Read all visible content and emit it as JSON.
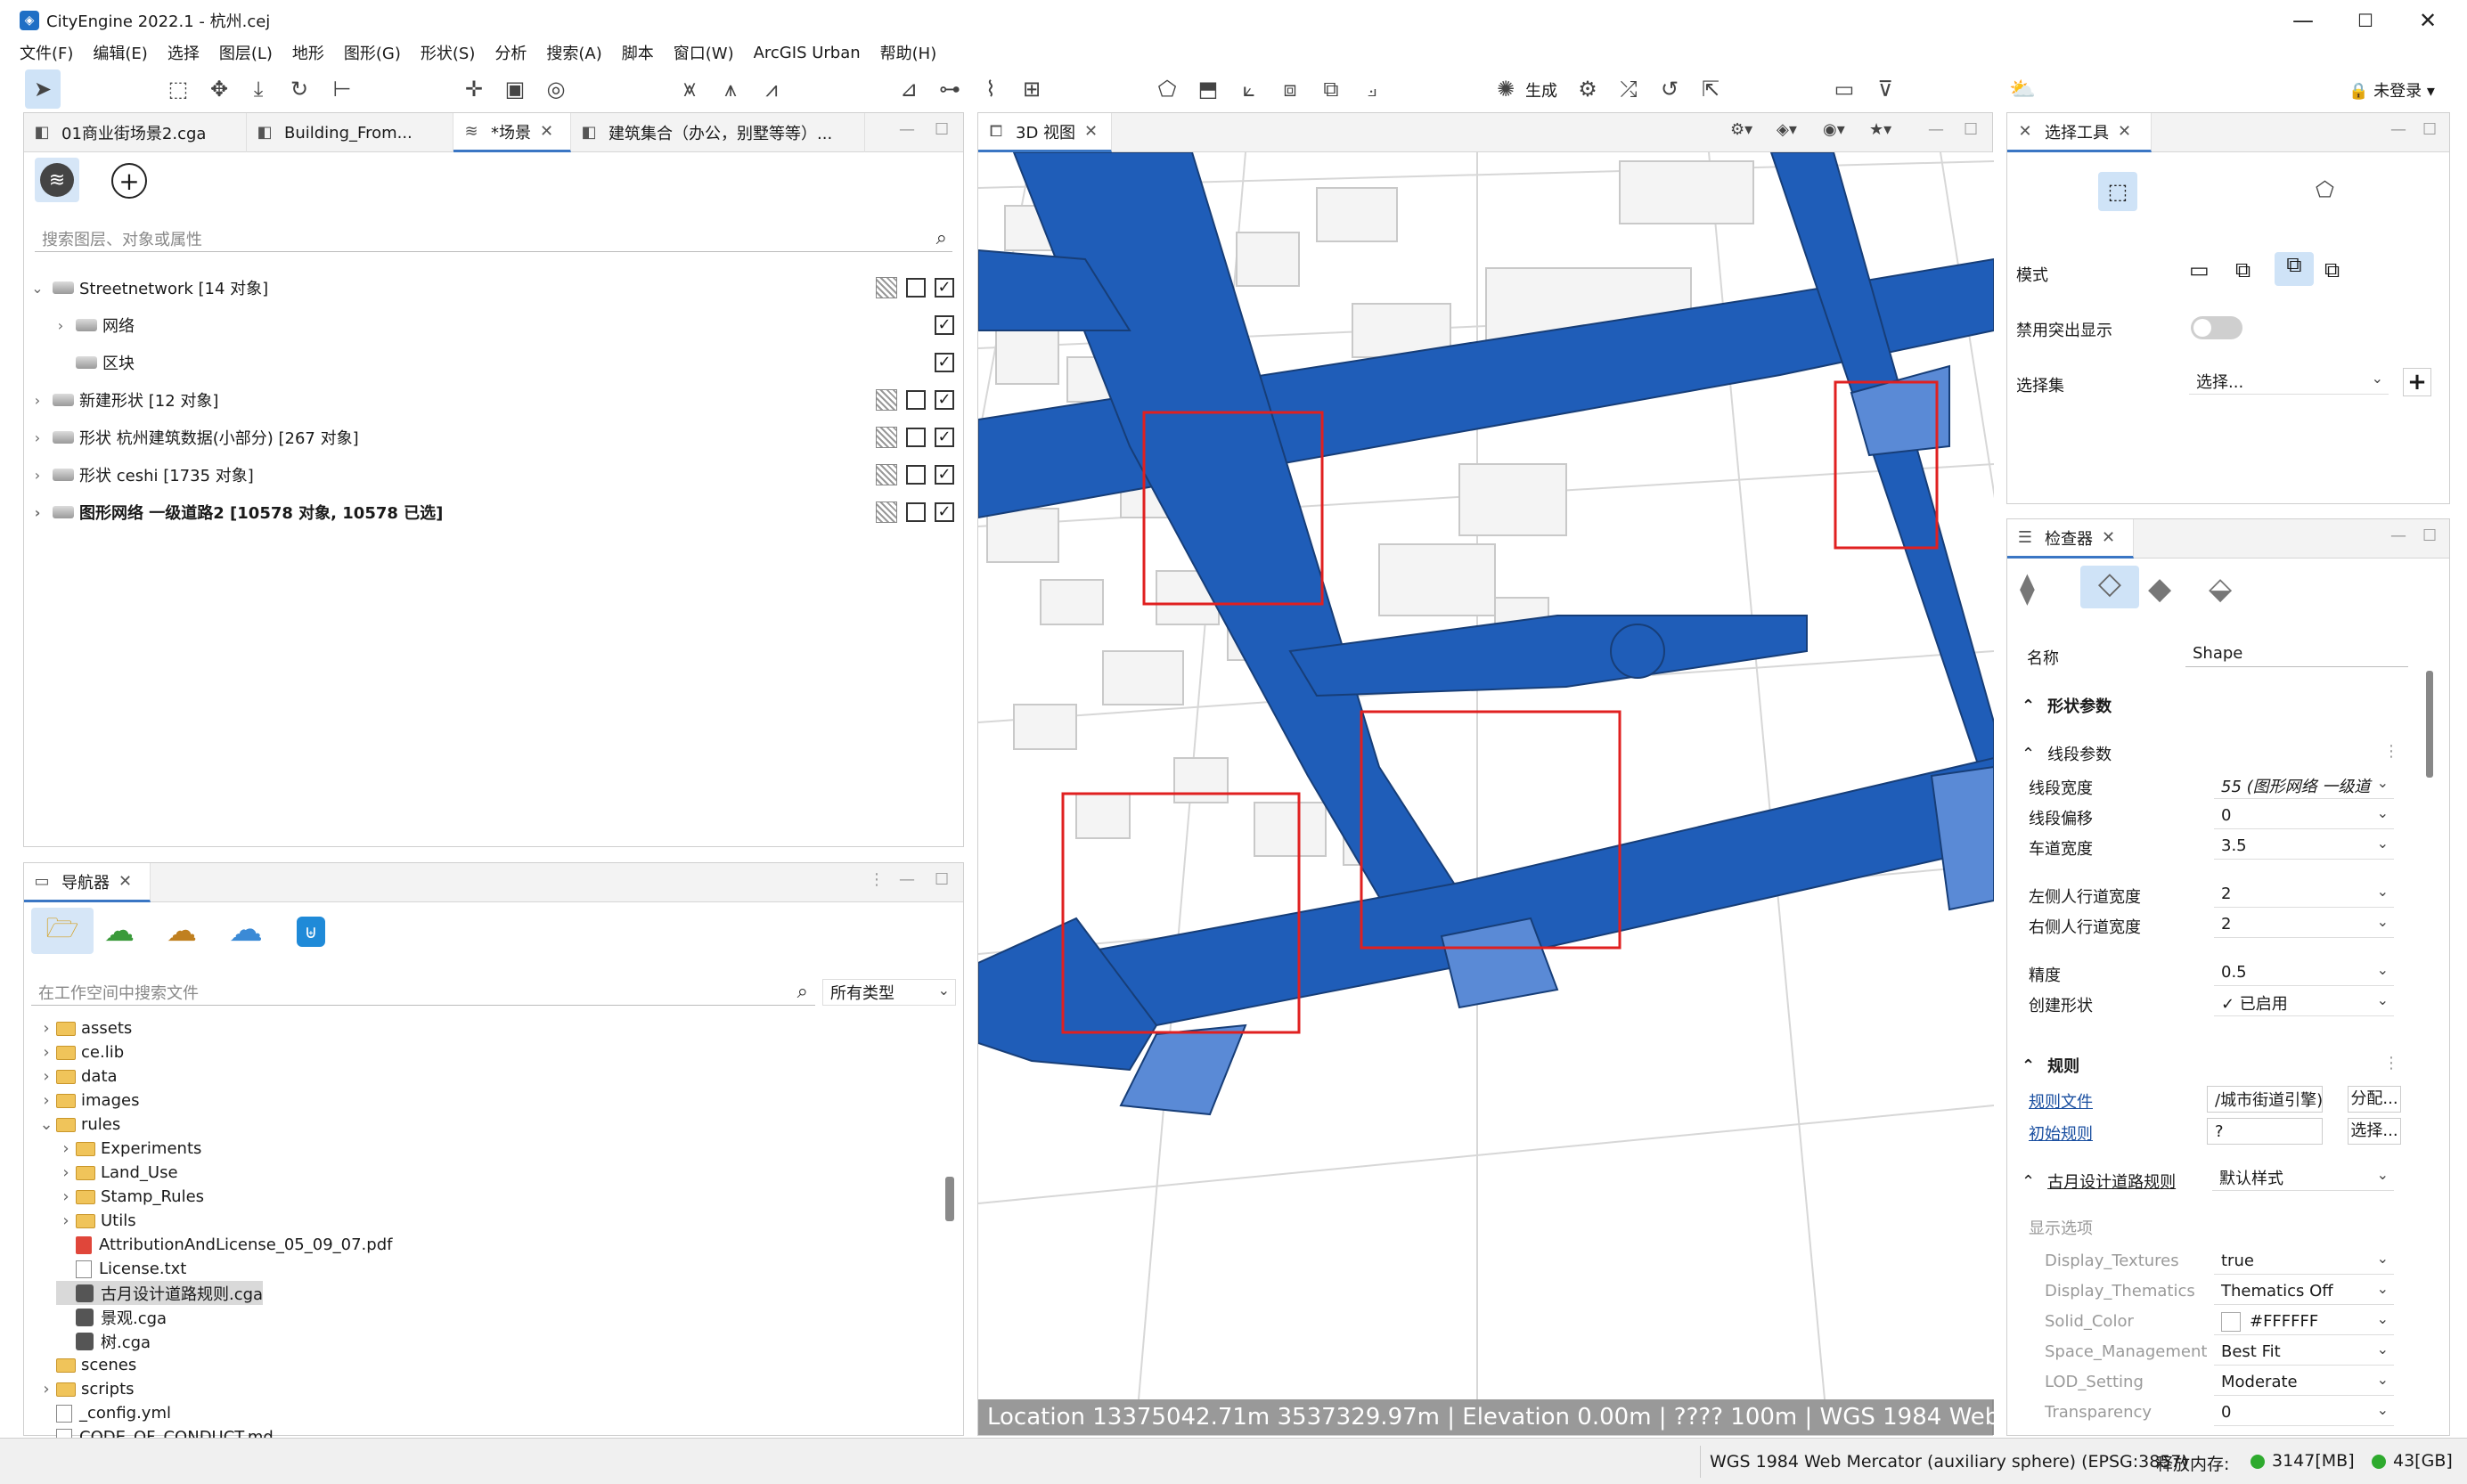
{
  "window": {
    "title": "CityEngine 2022.1 - 杭州.cej",
    "min": "—",
    "max": "☐",
    "close": "✕"
  },
  "menu": [
    "文件(F)",
    "编辑(E)",
    "选择",
    "图层(L)",
    "地形",
    "图形(G)",
    "形状(S)",
    "分析",
    "搜索(A)",
    "脚本",
    "窗口(W)",
    "ArcGIS Urban",
    "帮助(H)"
  ],
  "toolbar": {
    "generate_label": "生成",
    "login_label": "未登录"
  },
  "scene_panel": {
    "tabs": [
      "01商业街场景2.cga",
      "Building_From...",
      "*场景",
      "建筑集合（办公，别墅等等）..."
    ],
    "search_placeholder": "搜索图层、对象或属性",
    "layers": [
      {
        "label": "Streetnetwork [14 对象]",
        "bold": false
      },
      {
        "label": "网络",
        "bold": false
      },
      {
        "label": "区块",
        "bold": false
      },
      {
        "label": "新建形状 [12 对象]",
        "bold": false
      },
      {
        "label": "形状 杭州建筑数据(小部分) [267 对象]",
        "bold": false
      },
      {
        "label": "形状 ceshi [1735 对象]",
        "bold": false
      },
      {
        "label": "图形网络 一级道路2 [10578 对象, 10578 已选]",
        "bold": true
      }
    ]
  },
  "navigator": {
    "tab": "导航器",
    "search_placeholder": "在工作空间中搜索文件",
    "type_filter": "所有类型",
    "tree": [
      {
        "label": "assets",
        "kind": "folder",
        "indent": 1,
        "chev": "›"
      },
      {
        "label": "ce.lib",
        "kind": "folder",
        "indent": 1,
        "chev": "›"
      },
      {
        "label": "data",
        "kind": "folder",
        "indent": 1,
        "chev": "›"
      },
      {
        "label": "images",
        "kind": "folder",
        "indent": 1,
        "chev": "›"
      },
      {
        "label": "rules",
        "kind": "folder",
        "indent": 1,
        "chev": "⌄"
      },
      {
        "label": "Experiments",
        "kind": "folder",
        "indent": 2,
        "chev": "›"
      },
      {
        "label": "Land_Use",
        "kind": "folder",
        "indent": 2,
        "chev": "›"
      },
      {
        "label": "Stamp_Rules",
        "kind": "folder",
        "indent": 2,
        "chev": "›"
      },
      {
        "label": "Utils",
        "kind": "folder",
        "indent": 2,
        "chev": "›"
      },
      {
        "label": "AttributionAndLicense_05_09_07.pdf",
        "kind": "pdf",
        "indent": 2,
        "chev": ""
      },
      {
        "label": "License.txt",
        "kind": "file",
        "indent": 2,
        "chev": ""
      },
      {
        "label": "古月设计道路规则.cga",
        "kind": "cga",
        "indent": 2,
        "chev": "",
        "selected": true
      },
      {
        "label": "景观.cga",
        "kind": "cga",
        "indent": 2,
        "chev": ""
      },
      {
        "label": "树.cga",
        "kind": "cga",
        "indent": 2,
        "chev": ""
      },
      {
        "label": "scenes",
        "kind": "folder",
        "indent": 1,
        "chev": ""
      },
      {
        "label": "scripts",
        "kind": "folder",
        "indent": 1,
        "chev": "›"
      },
      {
        "label": "_config.yml",
        "kind": "file",
        "indent": 1,
        "chev": ""
      },
      {
        "label": "CODE_OF_CONDUCT.md",
        "kind": "file",
        "indent": 1,
        "chev": ""
      }
    ]
  },
  "viewport": {
    "tab": "3D 视图",
    "status": "Location 13375042.71m 3537329.97m  |  Elevation 0.00m   |  ???? 100m  |  WGS 1984 Web"
  },
  "select_tool": {
    "tab": "选择工具",
    "mode_label": "模式",
    "disable_highlight_label": "禁用突出显示",
    "selection_set_label": "选择集",
    "selection_set_value": "选择..."
  },
  "inspector": {
    "tab": "检查器",
    "name_label": "名称",
    "name_value": "Shape",
    "shape_params": "形状参数",
    "segment_params": "线段参数",
    "params": [
      {
        "label": "线段宽度",
        "value": "55 (图形网络 一级道"
      },
      {
        "label": "线段偏移",
        "value": "0"
      },
      {
        "label": "车道宽度",
        "value": "3.5"
      },
      {
        "label": "左侧人行道宽度",
        "value": "2"
      },
      {
        "label": "右侧人行道宽度",
        "value": "2"
      },
      {
        "label": "精度",
        "value": "0.5"
      },
      {
        "label": "创建形状",
        "value": "✓ 已启用"
      }
    ],
    "rules_section": "规则",
    "rule_file_label": "规则文件",
    "rule_file_value": "/城市街道引擎)",
    "assign_btn": "分配...",
    "start_rule_label": "初始规则",
    "start_rule_value": "?",
    "select_btn": "选择...",
    "rule_name": "古月设计道路规则",
    "rule_style": "默认样式",
    "display_options": "显示选项",
    "attrs": [
      {
        "label": "Display_Textures",
        "value": "true"
      },
      {
        "label": "Display_Thematics",
        "value": "Thematics Off"
      },
      {
        "label": "Solid_Color",
        "value": "#FFFFFF"
      },
      {
        "label": "Space_Management",
        "value": "Best Fit"
      },
      {
        "label": "LOD_Setting",
        "value": "Moderate"
      },
      {
        "label": "Transparency",
        "value": "0"
      }
    ]
  },
  "statusbar": {
    "crs": "WGS 1984 Web Mercator (auxiliary sphere) (EPSG:3857)",
    "free_mem_label": "释放内存:",
    "mem1": "3147[MB]",
    "mem2": "43[GB]"
  },
  "colors": {
    "road": "#1f5db8",
    "road_dark": "#173e78",
    "accent": "#3a76c4",
    "highlight": "#e02020"
  }
}
